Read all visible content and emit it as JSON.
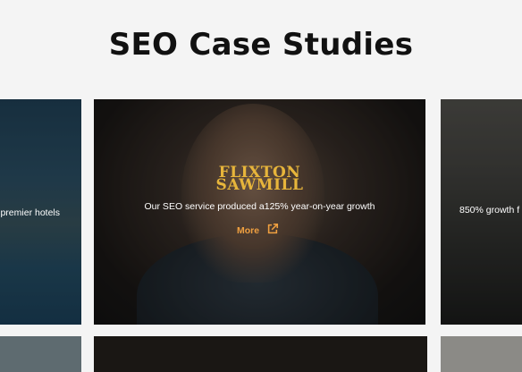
{
  "page": {
    "title": "SEO Case Studies"
  },
  "cards": {
    "left": {
      "text": "premier hotels"
    },
    "center": {
      "logo_line1": "FLIXTON",
      "logo_line2": "SAWMILL",
      "stat": "Our SEO service produced a125% year-on-year growth",
      "more_label": "More",
      "more_icon": "external-link-icon"
    },
    "right": {
      "text": "850% growth f"
    }
  },
  "colors": {
    "background": "#f4f4f4",
    "logo": "#e7b53b",
    "more": "#f0a040"
  }
}
